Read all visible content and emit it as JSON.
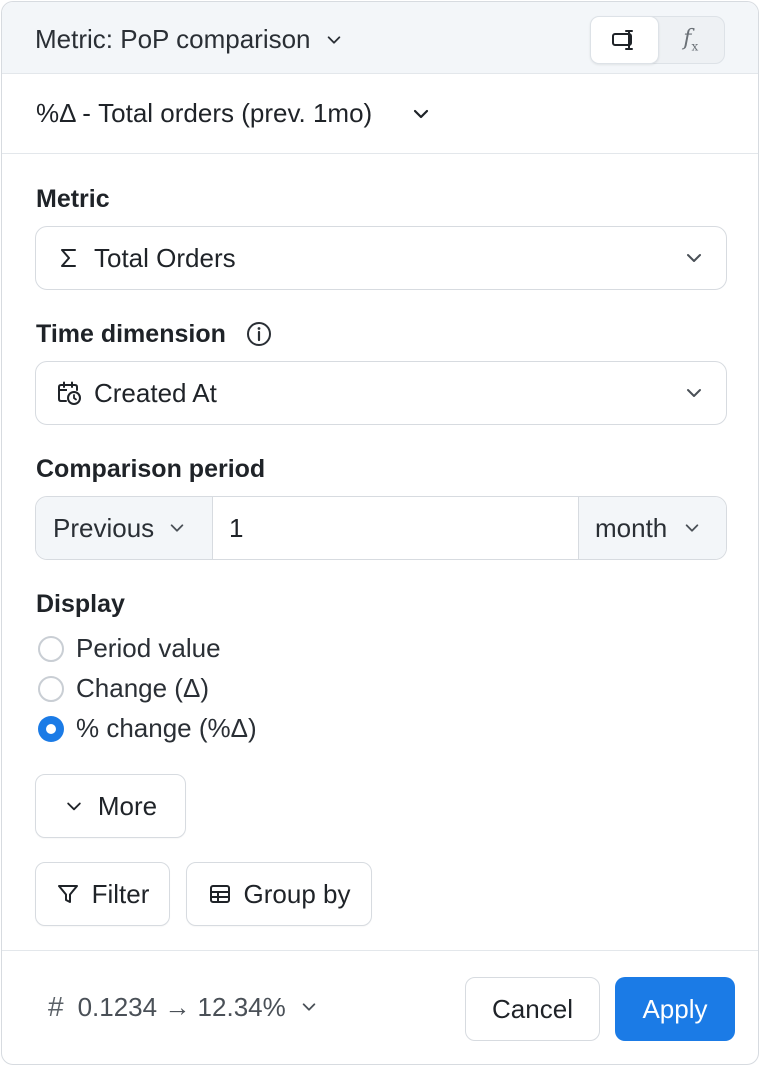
{
  "header": {
    "metric_type_label": "Metric: PoP comparison",
    "mode_buttons": [
      {
        "name": "visual-mode",
        "icon": "text-cursor-box-icon",
        "active": true
      },
      {
        "name": "formula-mode",
        "icon": "fx-icon",
        "label": "f",
        "sub": "x",
        "active": false
      }
    ]
  },
  "metric_name": "%Δ - Total orders (prev. 1mo)",
  "metric_field": {
    "label": "Metric",
    "icon": "sigma-icon",
    "value": "Total Orders"
  },
  "time_dimension": {
    "label": "Time dimension",
    "icon": "calendar-clock-icon",
    "value": "Created At"
  },
  "comparison_period": {
    "label": "Comparison period",
    "direction": "Previous",
    "amount": "1",
    "unit": "month"
  },
  "display": {
    "label": "Display",
    "options": [
      {
        "label": "Period value",
        "checked": false
      },
      {
        "label": "Change (Δ)",
        "checked": false
      },
      {
        "label": "% change (%Δ)",
        "checked": true
      }
    ]
  },
  "more_button": "More",
  "filter_button": "Filter",
  "group_by_button": "Group by",
  "footer": {
    "format_hash": "#",
    "format_example": "0.1234 → 12.34%",
    "cancel": "Cancel",
    "apply": "Apply"
  },
  "colors": {
    "accent": "#1b7be6",
    "header_bg": "#f3f6f9",
    "border": "#d7dbe0"
  }
}
